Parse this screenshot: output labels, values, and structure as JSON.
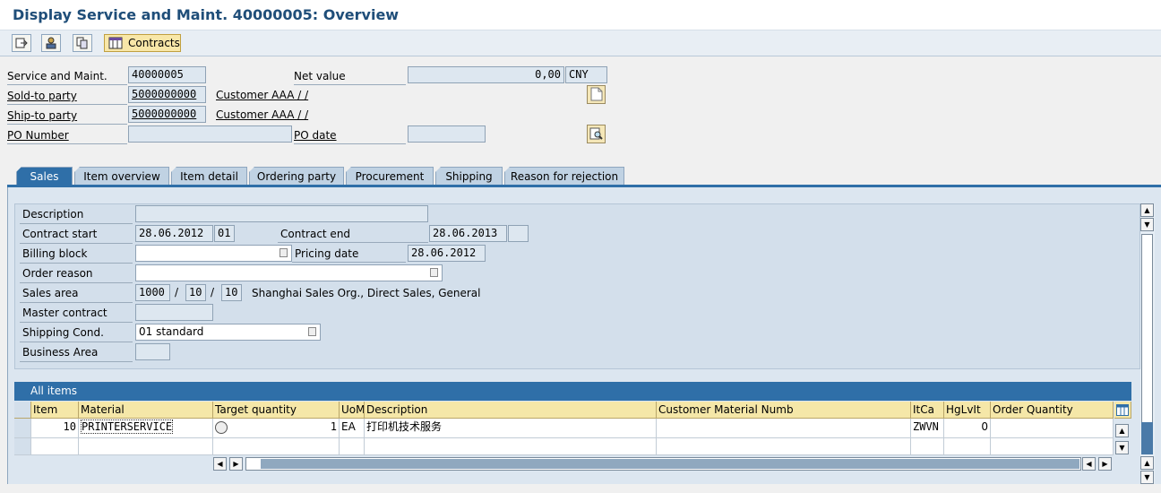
{
  "window_title": "Display Service and Maint. 40000005: Overview",
  "toolbar": {
    "contracts_label": "Contracts"
  },
  "header": {
    "service_label": "Service and Maint.",
    "service_value": "40000005",
    "net_value_label": "Net value",
    "net_value": "0,00",
    "currency": "CNY",
    "sold_to_label": "Sold-to party",
    "sold_to_value": "5000000000",
    "sold_to_name": "Customer AAA / /",
    "ship_to_label": "Ship-to party",
    "ship_to_value": "5000000000",
    "ship_to_name": "Customer AAA / /",
    "po_number_label": "PO Number",
    "po_number_value": "",
    "po_date_label": "PO date",
    "po_date_value": ""
  },
  "tabs": [
    {
      "label": "Sales",
      "active": true
    },
    {
      "label": "Item overview"
    },
    {
      "label": "Item detail"
    },
    {
      "label": "Ordering party"
    },
    {
      "label": "Procurement"
    },
    {
      "label": "Shipping"
    },
    {
      "label": "Reason for rejection"
    }
  ],
  "sales": {
    "description_label": "Description",
    "description_value": "",
    "contract_start_label": "Contract start",
    "contract_start_value": "28.06.2012",
    "contract_start_code": "01",
    "contract_end_label": "Contract end",
    "contract_end_value": "28.06.2013",
    "contract_end_code": "",
    "billing_block_label": "Billing block",
    "billing_block_value": "",
    "pricing_date_label": "Pricing date",
    "pricing_date_value": "28.06.2012",
    "order_reason_label": "Order reason",
    "order_reason_value": "",
    "sales_area_label": "Sales area",
    "sales_org": "1000",
    "dist_channel": "10",
    "division": "10",
    "sep1": "/",
    "sep2": "/",
    "sales_area_desc": "Shanghai Sales Org., Direct Sales, General",
    "master_contract_label": "Master contract",
    "master_contract_value": "",
    "shipping_cond_label": "Shipping Cond.",
    "shipping_cond_value": "01 standard",
    "business_area_label": "Business Area",
    "business_area_value": ""
  },
  "items": {
    "title": "All items",
    "columns": [
      "Item",
      "Material",
      "Target quantity",
      "UoM",
      "Description",
      "Customer Material Numb",
      "ItCa",
      "HgLvIt",
      "Order Quantity"
    ],
    "rows": [
      {
        "item": "10",
        "material": "PRINTERSERVICE",
        "target_qty": "1",
        "uom": "EA",
        "description": "打印机技术服务",
        "cust_mat": "",
        "itca": "ZWVN",
        "hglvit": "0",
        "order_qty": ""
      }
    ]
  }
}
